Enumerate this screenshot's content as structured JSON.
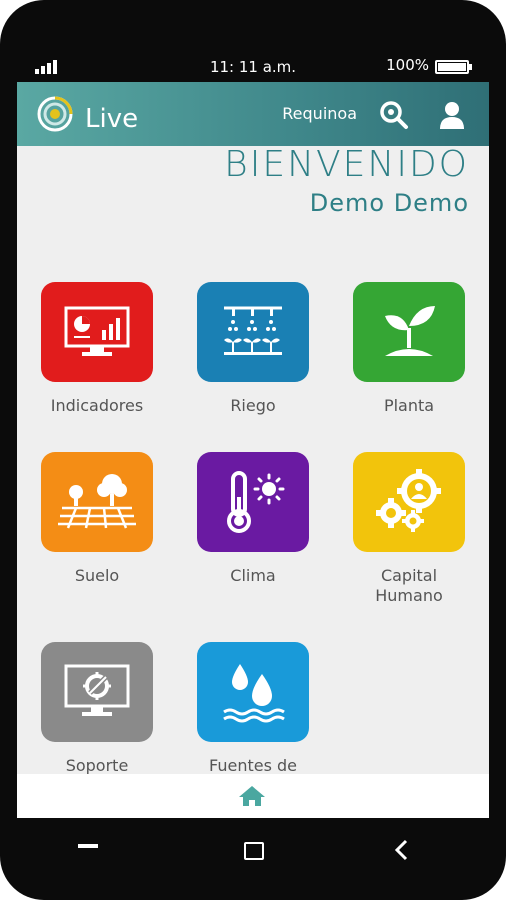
{
  "status": {
    "time": "11: 11 a.m.",
    "battery": "100%"
  },
  "header": {
    "logo_text": "Live",
    "farm": "Requinoa",
    "search_icon": "search-icon",
    "user_icon": "user-icon"
  },
  "welcome": {
    "title": "BIENVENIDO",
    "user": "Demo Demo"
  },
  "tiles": [
    {
      "label": "Indicadores",
      "color": "#e11c1c",
      "icon": "indicators-monitor-icon"
    },
    {
      "label": "Riego",
      "color": "#1a80b4",
      "icon": "irrigation-icon"
    },
    {
      "label": "Planta",
      "color": "#35a634",
      "icon": "plant-icon"
    },
    {
      "label": "Suelo",
      "color": "#f48d15",
      "icon": "soil-icon"
    },
    {
      "label": "Clima",
      "color": "#6a1aa2",
      "icon": "thermometer-sun-icon"
    },
    {
      "label": "Capital\nHumano",
      "color": "#f2c40c",
      "icon": "gears-person-icon"
    },
    {
      "label": "Soporte",
      "color": "#8a8a8a",
      "icon": "support-monitor-icon"
    },
    {
      "label": "Fuentes de",
      "color": "#199ad9",
      "icon": "water-drops-icon"
    }
  ],
  "bottom_nav": {
    "home_icon": "home-icon",
    "accent": "#4aa7a0"
  }
}
